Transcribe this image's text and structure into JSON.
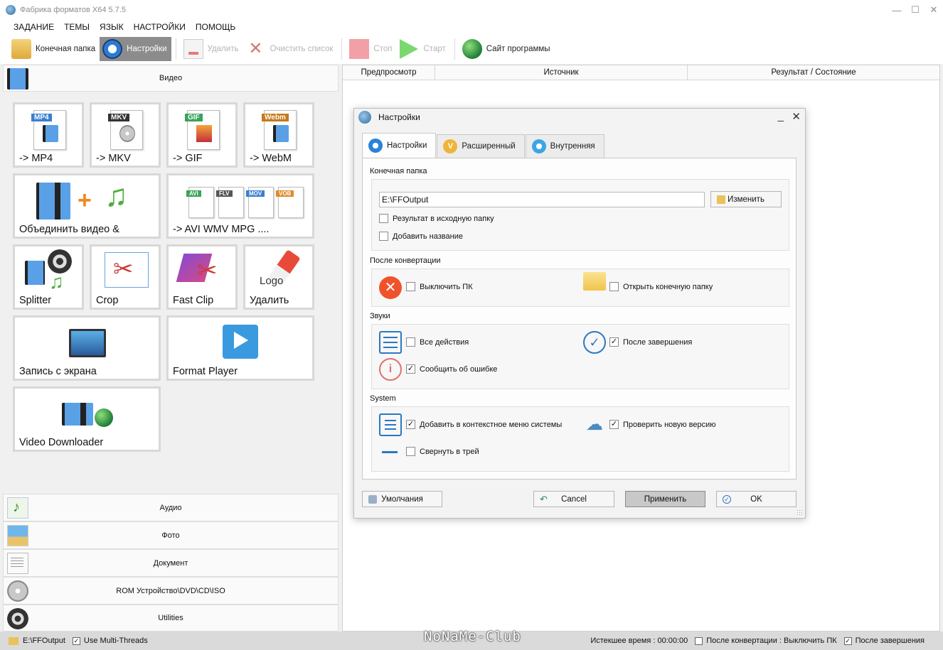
{
  "window": {
    "title": "Фабрика форматов X64 5.7.5",
    "controls": [
      "—",
      "☐",
      "✕"
    ]
  },
  "menu": [
    "ЗАДАНИЕ",
    "ТЕМЫ",
    "ЯЗЫК",
    "НАСТРОЙКИ",
    "ПОМОЩЬ"
  ],
  "toolbar": {
    "output_folder": "Конечная папка",
    "settings": "Настройки",
    "remove": "Удалить",
    "clear_list": "Очистить список",
    "stop": "Стоп",
    "start": "Старт",
    "website": "Сайт программы"
  },
  "left": {
    "video_header": "Видео",
    "tiles": {
      "mp4": {
        "label": "-> MP4",
        "badge": "MP4",
        "color": "#3a7fd0"
      },
      "mkv": {
        "label": "-> MKV",
        "badge": "MKV",
        "color": "#333333"
      },
      "gif": {
        "label": "-> GIF",
        "badge": "GIF",
        "color": "#3aa35a"
      },
      "webm": {
        "label": "-> WebM",
        "badge": "Webm",
        "color": "#c47a1c"
      },
      "join": {
        "label": "Объединить видео &"
      },
      "avi": {
        "label": "-> AVI WMV MPG ....",
        "badges": [
          "AVI",
          "FLV",
          "MOV",
          "VOB"
        ]
      },
      "splitter": {
        "label": "Splitter"
      },
      "crop": {
        "label": "Crop"
      },
      "fastclip": {
        "label": "Fast Clip"
      },
      "logo": {
        "label": "Удалить",
        "overlay": "Logo"
      },
      "screen": {
        "label": "Запись с экрана"
      },
      "player": {
        "label": "Format Player"
      },
      "downloader": {
        "label": "Video Downloader"
      }
    },
    "categories": [
      "Аудио",
      "Фото",
      "Документ",
      "ROM Устройство\\DVD\\CD\\ISO",
      "Utilities"
    ]
  },
  "list": {
    "columns": [
      "Предпросмотр",
      "Источник",
      "Результат / Состояние"
    ]
  },
  "status": {
    "path": "E:\\FFOutput",
    "multithreads": "Use Multi-Threads",
    "elapsed": "Истекшее время : 00:00:00",
    "after_conv": "После конвертации : Выключить ПК",
    "after_done": "После завершения"
  },
  "watermark": "NoNaMe-Club",
  "dialog": {
    "title": "Настройки",
    "tabs": [
      "Настройки",
      "Расширенный",
      "Внутренняя"
    ],
    "output_folder_label": "Конечная папка",
    "output_path": "E:\\FFOutput",
    "change": "Изменить",
    "result_to_source": "Результат в исходную папку",
    "add_name": "Добавить название",
    "after_conv_label": "После конвертации",
    "shutdown": "Выключить ПК",
    "open_folder": "Открыть конечную папку",
    "sounds_label": "Звуки",
    "all_actions": "Все действия",
    "after_finish": "После завершения",
    "report_error": "Сообщить об ошибке",
    "system_label": "System",
    "context_menu": "Добавить в контекстное меню системы",
    "check_update": "Проверить новую версию",
    "minimize_tray": "Свернуть в трей",
    "defaults": "Умолчания",
    "cancel": "Cancel",
    "apply": "Применить",
    "ok": "OK",
    "checked": {
      "result_to_source": false,
      "add_name": false,
      "shutdown": false,
      "open_folder": false,
      "all_actions": false,
      "after_finish": true,
      "report_error": true,
      "context_menu": true,
      "check_update": true,
      "minimize_tray": false
    }
  },
  "colors": {
    "active_toolbar": "#8c8c8c",
    "accent_blue": "#2b78c2",
    "shutdown_red": "#f0522c"
  }
}
